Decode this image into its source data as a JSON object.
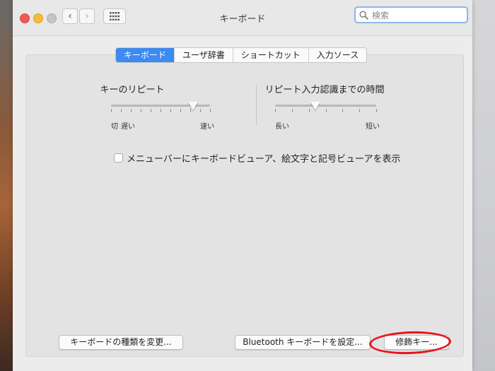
{
  "window": {
    "title": "キーボード"
  },
  "toolbar": {
    "back_glyph": "‹",
    "forward_glyph": "›",
    "grid_icon": "grid-icon"
  },
  "search": {
    "placeholder": "検索",
    "icon": "search-icon"
  },
  "tabs": [
    {
      "label": "キーボード",
      "active": true
    },
    {
      "label": "ユーザ辞書",
      "active": false
    },
    {
      "label": "ショートカット",
      "active": false
    },
    {
      "label": "入力ソース",
      "active": false
    }
  ],
  "key_repeat": {
    "title": "キーのリピート",
    "label_off": "切",
    "label_slow": "遅い",
    "label_fast": "速い",
    "value_fraction": 0.83
  },
  "repeat_delay": {
    "title": "リピート入力認識までの時間",
    "label_long": "長い",
    "label_short": "短い",
    "value_fraction": 0.4
  },
  "keyboard_viewer_checkbox": {
    "label": "メニューバーにキーボードビューア、絵文字と記号ビューアを表示",
    "checked": false
  },
  "buttons": {
    "change_type": "キーボードの種類を変更...",
    "bluetooth": "Bluetooth キーボードを設定...",
    "modifier": "修飾キー..."
  },
  "colors": {
    "accent": "#3d8af0",
    "close": "#ee5b54",
    "minimize": "#f3bc3a",
    "annotation": "#e8121b"
  }
}
